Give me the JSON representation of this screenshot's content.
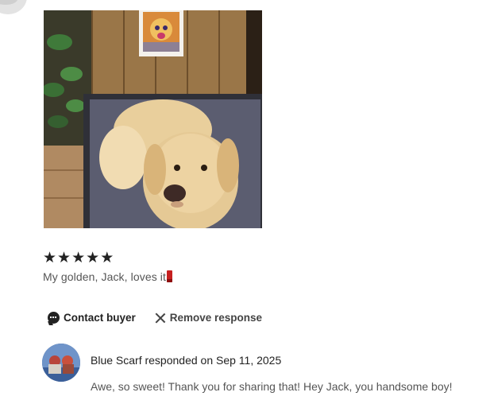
{
  "review": {
    "rating": 5,
    "stars": [
      "★",
      "★",
      "★",
      "★",
      "★"
    ],
    "text": "My golden, Jack, loves it",
    "emoji_icon": "double-exclamation-icon",
    "photo_alt": "golden retriever photo"
  },
  "actions": {
    "contact_label": "Contact buyer",
    "contact_icon": "chat-bubble-icon",
    "remove_label": "Remove response",
    "remove_icon": "close-icon"
  },
  "response": {
    "shop_name": "Blue Scarf",
    "responder_line": "Blue Scarf responded on Sep 11, 2025",
    "text": "Awe, so sweet! Thank you for sharing that! Hey Jack, you handsome boy!"
  },
  "colors": {
    "text_primary": "#222222",
    "text_secondary": "#555555",
    "star": "#222222"
  }
}
